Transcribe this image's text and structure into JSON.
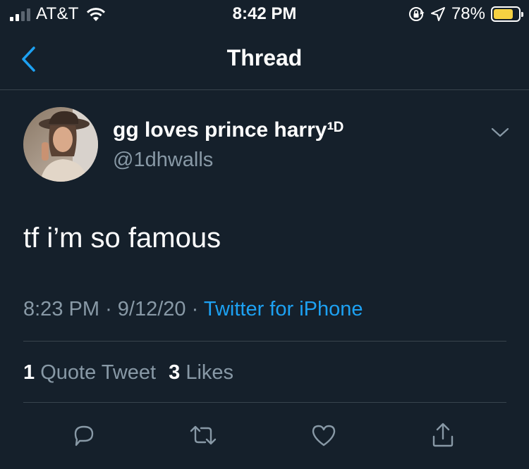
{
  "status_bar": {
    "carrier": "AT&T",
    "time": "8:42 PM",
    "battery_percent": "78%",
    "battery_level": 0.78,
    "battery_color": "#f5d142",
    "signal_bars_filled": 2,
    "signal_bars_total": 4,
    "icons": [
      "wifi-icon",
      "rotation-lock-icon",
      "location-arrow-icon",
      "battery-icon"
    ]
  },
  "navbar": {
    "title": "Thread",
    "back_icon": "chevron-left-icon"
  },
  "tweet": {
    "author_name": "gg loves prince harry¹ᴰ",
    "author_handle": "@1dhwalls",
    "text": "tf i’m so famous",
    "time": "8:23 PM",
    "date": "9/12/20",
    "separator": "·",
    "source": "Twitter for iPhone",
    "menu_icon": "chevron-down-icon"
  },
  "stats": {
    "quote_count": "1",
    "quote_label": "Quote Tweet",
    "like_count": "3",
    "like_label": "Likes"
  },
  "actions": [
    "reply-icon",
    "retweet-icon",
    "like-icon",
    "share-icon"
  ],
  "colors": {
    "background": "#15202b",
    "secondary_text": "#8899a6",
    "accent": "#1da1f2",
    "divider": "#38444d"
  }
}
